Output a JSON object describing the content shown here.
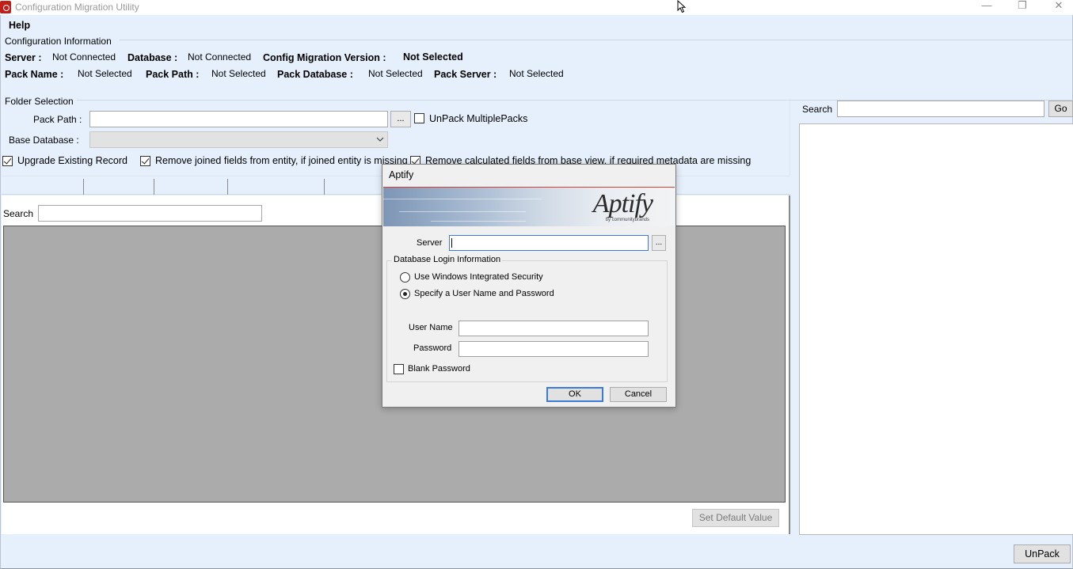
{
  "window": {
    "title": "Configuration Migration Utility",
    "controls": {
      "minimize": "—",
      "maximize": "❐",
      "close": "✕"
    }
  },
  "menu": {
    "help": "Help"
  },
  "config_info": {
    "group_label": "Configuration Information",
    "server_label": "Server :",
    "server_value": "Not Connected",
    "database_label": "Database :",
    "database_value": "Not Connected",
    "version_label": "Config Migration Version :",
    "version_value": "Not Selected",
    "pack_name_label": "Pack Name :",
    "pack_name_value": "Not Selected",
    "pack_path_label": "Pack Path :",
    "pack_path_value": "Not Selected",
    "pack_database_label": "Pack Database :",
    "pack_database_value": "Not Selected",
    "pack_server_label": "Pack Server :",
    "pack_server_value": "Not Selected"
  },
  "folder_selection": {
    "group_label": "Folder Selection",
    "pack_path_label": "Pack Path :",
    "pack_path_value": "",
    "browse_label": "...",
    "unpack_multiple_label": "UnPack MultiplePacks",
    "unpack_multiple_checked": false,
    "base_database_label": "Base Database :",
    "base_database_value": "",
    "upgrade_existing_label": "Upgrade Existing Record",
    "upgrade_existing_checked": true,
    "remove_joined_label": "Remove joined fields from entity, if joined entity is missing",
    "remove_joined_checked": true,
    "remove_calculated_label": "Remove calculated fields from base view, if required metadata are missing",
    "remove_calculated_checked": true
  },
  "content": {
    "search_label": "Search",
    "search_value": "",
    "set_default_label": "Set Default Value"
  },
  "right_panel": {
    "search_label": "Search",
    "search_value": "",
    "go_label": "Go",
    "unpack_label": "UnPack"
  },
  "dialog": {
    "title": "Aptify",
    "logo_text": "Aptify",
    "logo_sub": "by communitybrands",
    "server_label": "Server",
    "server_value": "",
    "server_browse_label": "...",
    "login_group_label": "Database Login Information",
    "windows_security_label": "Use Windows Integrated Security",
    "windows_security_selected": false,
    "specify_user_label": "Specify a User Name and Password",
    "specify_user_selected": true,
    "username_label": "User Name",
    "username_value": "",
    "password_label": "Password",
    "password_value": "",
    "blank_password_label": "Blank Password",
    "blank_password_checked": false,
    "ok_label": "OK",
    "cancel_label": "Cancel"
  },
  "colors": {
    "window_bg": "#e6f0fc",
    "grid_bg": "#ababab",
    "focus_blue": "#3b7bd4",
    "app_icon_red": "#c0201a"
  }
}
